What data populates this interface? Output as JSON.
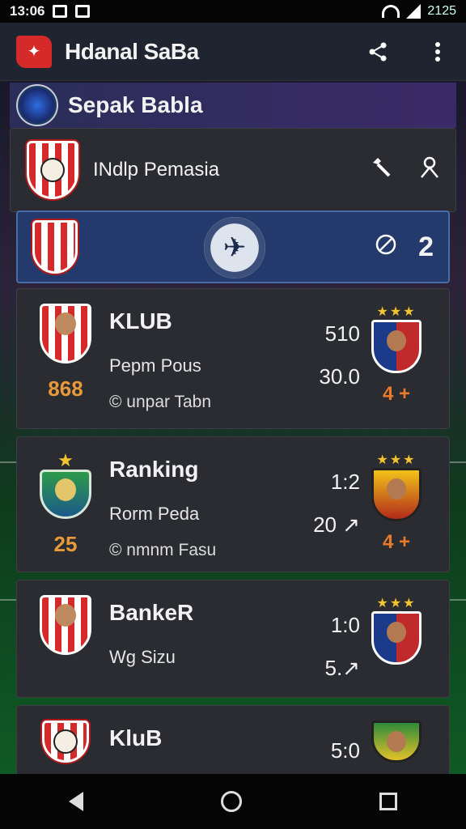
{
  "status": {
    "time": "13:06",
    "battery": "2125"
  },
  "app_bar": {
    "title": "Hdanal SaBa"
  },
  "league": {
    "title": "Sepak Babla"
  },
  "team": {
    "name": "INdlp Pemasia"
  },
  "match": {
    "count": "2"
  },
  "players": [
    {
      "title": "KLUB",
      "sub": "Pepm Pous",
      "meta": "© unpar Tabn",
      "rank": "868",
      "score_a": "510",
      "score_b": "30.0",
      "rival": "4 +"
    },
    {
      "title": "Ranking",
      "sub": "Rorm Peda",
      "meta": "© nmnm Fasu",
      "rank": "25",
      "score_a": "1:2",
      "score_b": "20 ↗",
      "rival": "4 +"
    },
    {
      "title": "BankeR",
      "sub": "Wg Sizu",
      "meta": "",
      "rank": "",
      "score_a": "1:0",
      "score_b": "5.↗",
      "rival": ""
    },
    {
      "title": "KluB",
      "sub": "",
      "meta": "",
      "rank": "",
      "score_a": "5:0",
      "score_b": "",
      "rival": ""
    }
  ],
  "icons": {
    "share": "share-icon",
    "more": "more-vert-icon",
    "edit": "wrench-icon",
    "profile": "person-icon",
    "globe": "globe-icon"
  }
}
